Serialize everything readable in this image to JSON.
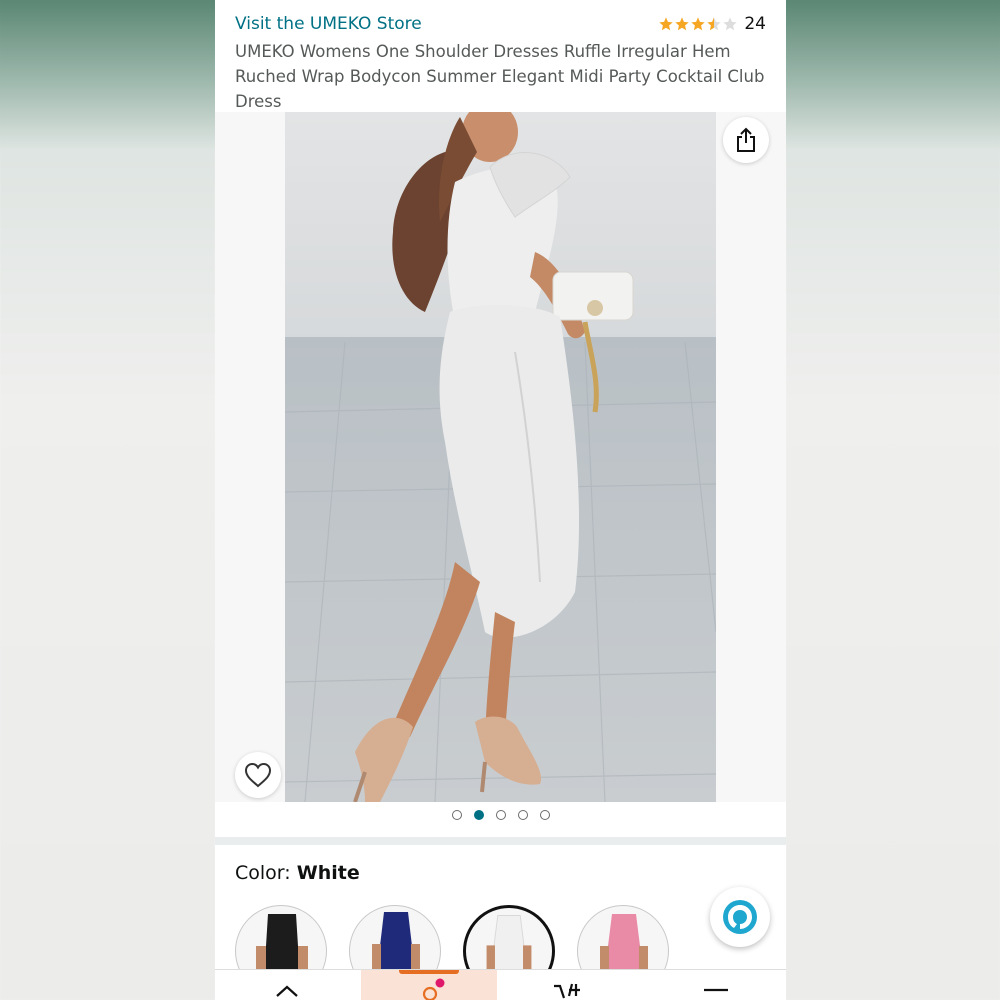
{
  "header": {
    "store_link": "Visit the UMEKO Store",
    "rating_stars": 3.5,
    "rating_count": "24",
    "product_title": "UMEKO Womens One Shoulder Dresses Ruffle Irregular Hem Ruched Wrap Bodycon Summer Elegant Midi Party Cocktail Club Dress"
  },
  "gallery": {
    "image_count": 5,
    "active_index": 1
  },
  "color": {
    "label": "Color:",
    "selected": "White",
    "swatches": [
      "black",
      "navy",
      "white",
      "pink"
    ],
    "selected_index": 2
  },
  "colors": {
    "link": "#007185",
    "star": "#f5a623",
    "nav_accent": "#e66e22",
    "alexa": "#1fa7cf"
  },
  "icons": {
    "share": "share-icon",
    "heart": "heart-icon",
    "alexa": "alexa-icon"
  }
}
